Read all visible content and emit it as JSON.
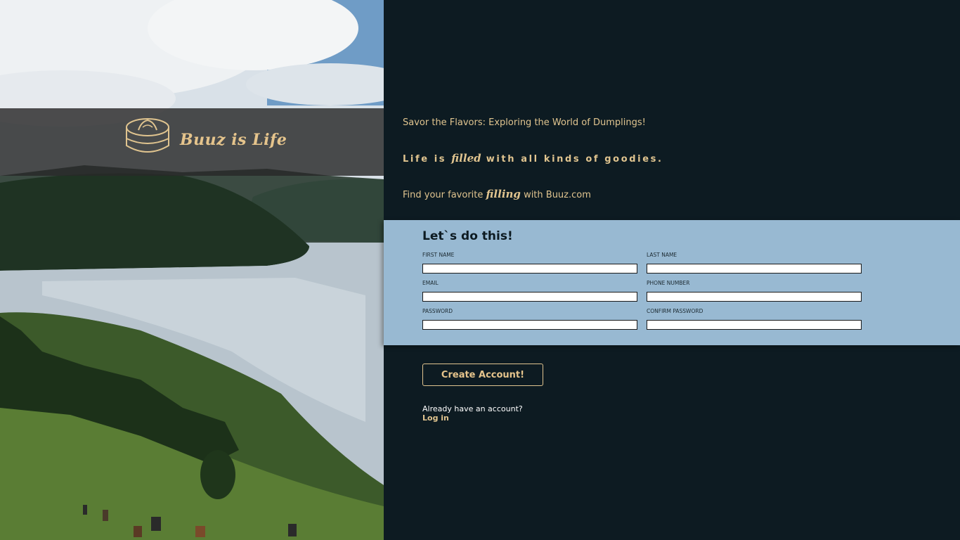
{
  "brand": {
    "name": "Buuz is Life",
    "logo_icon": "dumpling-steamer-icon",
    "accent_color": "#e0c48f"
  },
  "hero": {
    "tagline": "Savor the Flavors: Exploring the World of Dumplings!",
    "motto_before": "Life is",
    "motto_script": "filled",
    "motto_after": "with all kinds of goodies.",
    "find_before": "Find your favorite",
    "find_script": "filling",
    "find_after": "with Buuz.com"
  },
  "signup": {
    "title": "Let`s do this!",
    "panel_color": "#98b9d2",
    "fields": {
      "first_name": {
        "label": "FIRST NAME",
        "value": ""
      },
      "last_name": {
        "label": "LAST NAME",
        "value": ""
      },
      "email": {
        "label": "EMAIL",
        "value": ""
      },
      "phone": {
        "label": "PHONE NUMBER",
        "value": ""
      },
      "password": {
        "label": "PASSWORD",
        "value": ""
      },
      "confirm_password": {
        "label": "CONFIRM PASSWORD",
        "value": ""
      }
    },
    "submit_label": "Create Account!"
  },
  "login": {
    "prompt": "Already have an account?",
    "link_label": "Log in"
  }
}
